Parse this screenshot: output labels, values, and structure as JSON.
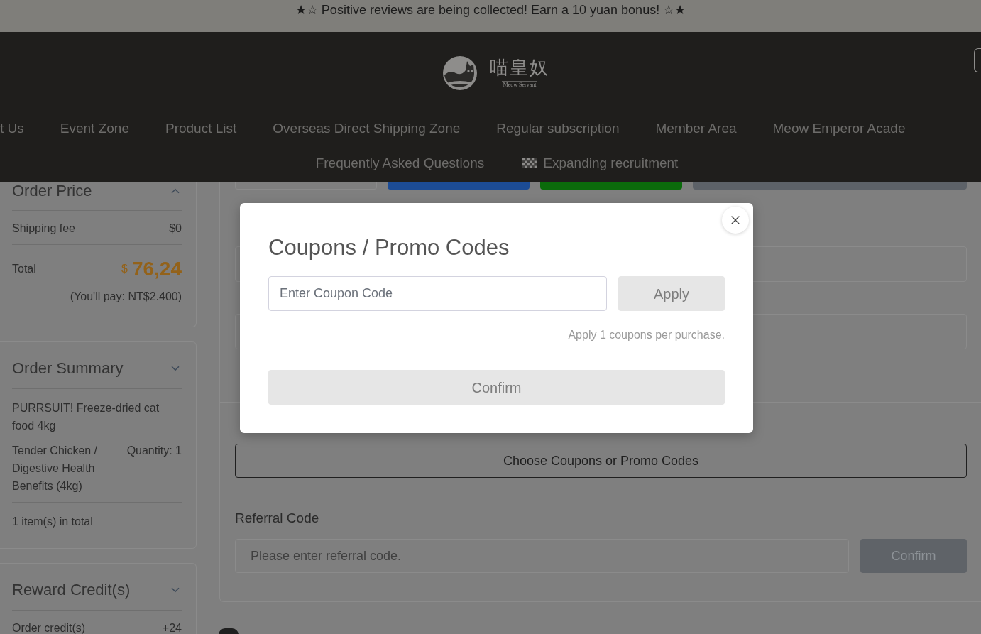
{
  "announcement": "★☆ Positive reviews are being collected! Earn a 10 yuan bonus! ☆★",
  "header": {
    "logo": {
      "name": "喵皇奴",
      "tagline": "Meow Servant"
    },
    "nav_rows": [
      {
        "items": [
          {
            "kind": "text",
            "label": "t Us"
          },
          {
            "kind": "text",
            "label": "Event Zone"
          },
          {
            "kind": "text",
            "label": "Product List"
          },
          {
            "kind": "text",
            "label": "Overseas Direct Shipping Zone"
          },
          {
            "kind": "text",
            "label": "Regular subscription"
          },
          {
            "kind": "text",
            "label": "Member Area"
          },
          {
            "kind": "text",
            "label": "Meow Emperor Acade"
          }
        ]
      },
      {
        "items": [
          {
            "kind": "text",
            "label": "Frequently Asked Questions"
          },
          {
            "kind": "icon",
            "label": "Expanding recruitment"
          }
        ]
      }
    ]
  },
  "sidebar": {
    "cards": [
      {
        "title": "Order Price",
        "expanded": true,
        "sections": [
          {
            "kind": "row",
            "label": "Shipping fee",
            "value": "$0"
          },
          {
            "kind": "total",
            "label": "Total",
            "currency": "$",
            "amount": "76,24",
            "note": "(You'll pay: NT$2.400)"
          }
        ]
      },
      {
        "title": "Order Summary",
        "expanded": false,
        "sections": [
          {
            "kind": "product",
            "name": "PURRSUIT! Freeze-dried cat food 4kg",
            "variant": "Tender Chicken / Digestive Health Benefits (4kg)",
            "quantity": "Quantity: 1"
          },
          {
            "kind": "footer",
            "text": "1 item(s) in total"
          }
        ]
      },
      {
        "title": "Reward Credit(s)",
        "expanded": false,
        "sections": [
          {
            "kind": "row",
            "label": "Order credit(s)",
            "value": "+24"
          }
        ]
      }
    ]
  },
  "checkout": {
    "coupon_button": "Choose Coupons or Promo Codes",
    "referral": {
      "label": "Referral Code",
      "placeholder": "Please enter referral code.",
      "button": {
        "label": "Confirm",
        "disabled": true
      }
    }
  },
  "modal": {
    "title": "Coupons / Promo Codes",
    "input": {
      "placeholder": "Enter Coupon Code"
    },
    "apply_button": {
      "label": "Apply",
      "disabled": true
    },
    "note": "Apply 1 coupons per purchase.",
    "confirm_button": {
      "label": "Confirm",
      "disabled": true
    }
  }
}
